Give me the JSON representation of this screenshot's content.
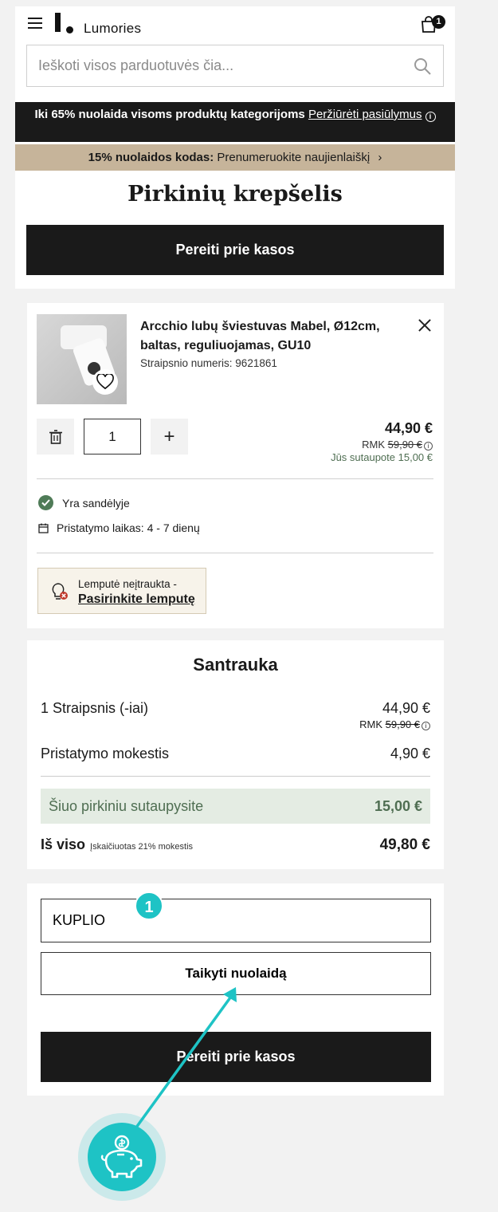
{
  "header": {
    "logo_text": "Lumories",
    "cart_count": "1",
    "search_placeholder": "Ieškoti visos parduotuvės čia..."
  },
  "promo": {
    "black_bold": "Iki 65% nuolaida visoms produktų kategorijoms",
    "black_link": "Peržiūrėti pasiūlymus",
    "beige_bold": "15% nuolaidos kodas:",
    "beige_text": "Prenumeruokite naujienlaiškį",
    "beige_chevron": "›"
  },
  "page": {
    "title": "Pirkinių krepšelis",
    "checkout_label": "Pereiti prie kasos"
  },
  "product": {
    "name": "Arcchio lubų šviestuvas Mabel, Ø12cm, baltas, reguliuojamas, GU10",
    "sku": "Straipsnio numeris: 9621861",
    "quantity": "1",
    "plus": "+",
    "price": "44,90 €",
    "rmk_label": "RMK",
    "rmk_price": "59,90 €",
    "savings": "Jūs sutaupote 15,00 €",
    "stock": "Yra sandėlyje",
    "delivery": "Pristatymo laikas: 4 - 7 dienų",
    "bulb_note": "Lemputė neįtraukta -",
    "bulb_link": "Pasirinkite lemputę"
  },
  "summary": {
    "title": "Santrauka",
    "items_label": "1 Straipsnis (-iai)",
    "items_value": "44,90 €",
    "rmk_label": "RMK",
    "rmk_value": "59,90 €",
    "shipping_label": "Pristatymo mokestis",
    "shipping_value": "4,90 €",
    "save_label": "Šiuo pirkiniu sutaupysite",
    "save_value": "15,00 €",
    "total_label": "Iš viso",
    "tax_note": "Įskaičiuotas 21% mokestis",
    "total_value": "49,80 €"
  },
  "coupon": {
    "value": "KUPLIO",
    "apply_label": "Taikyti nuolaidą",
    "checkout_label": "Pereiti prie kasos"
  },
  "overlay": {
    "step_number": "1",
    "accent": "#1ec3c5"
  }
}
